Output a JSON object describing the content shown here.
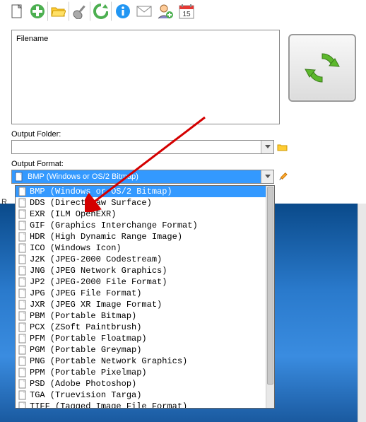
{
  "toolbar": {
    "new": "new-file",
    "add": "add",
    "open": "open-folder",
    "settings": "settings",
    "refresh": "refresh",
    "info": "info",
    "mail": "mail",
    "user": "add-user",
    "cal": "calendar",
    "cal_day": "15"
  },
  "filelist": {
    "header": "Filename"
  },
  "output_folder": {
    "label": "Output Folder:",
    "value": ""
  },
  "output_format": {
    "label": "Output Format:",
    "selected": "BMP (Windows or OS/2 Bitmap)"
  },
  "formats": [
    "BMP (Windows or OS/2 Bitmap)",
    "DDS (DirectDraw Surface)",
    "EXR (ILM OpenEXR)",
    "GIF (Graphics Interchange Format)",
    "HDR (High Dynamic Range Image)",
    "ICO (Windows Icon)",
    "J2K (JPEG-2000 Codestream)",
    "JNG (JPEG Network Graphics)",
    "JP2 (JPEG-2000 File Format)",
    "JPG (JPEG File Format)",
    "JXR (JPEG XR Image Format)",
    "PBM (Portable Bitmap)",
    "PCX (ZSoft Paintbrush)",
    "PFM (Portable Floatmap)",
    "PGM (Portable Greymap)",
    "PNG (Portable Network Graphics)",
    "PPM (Portable Pixelmap)",
    "PSD (Adobe Photoshop)",
    "TGA (Truevision Targa)",
    "TIFF (Tagged Image File Format)"
  ],
  "side_letter": "R"
}
